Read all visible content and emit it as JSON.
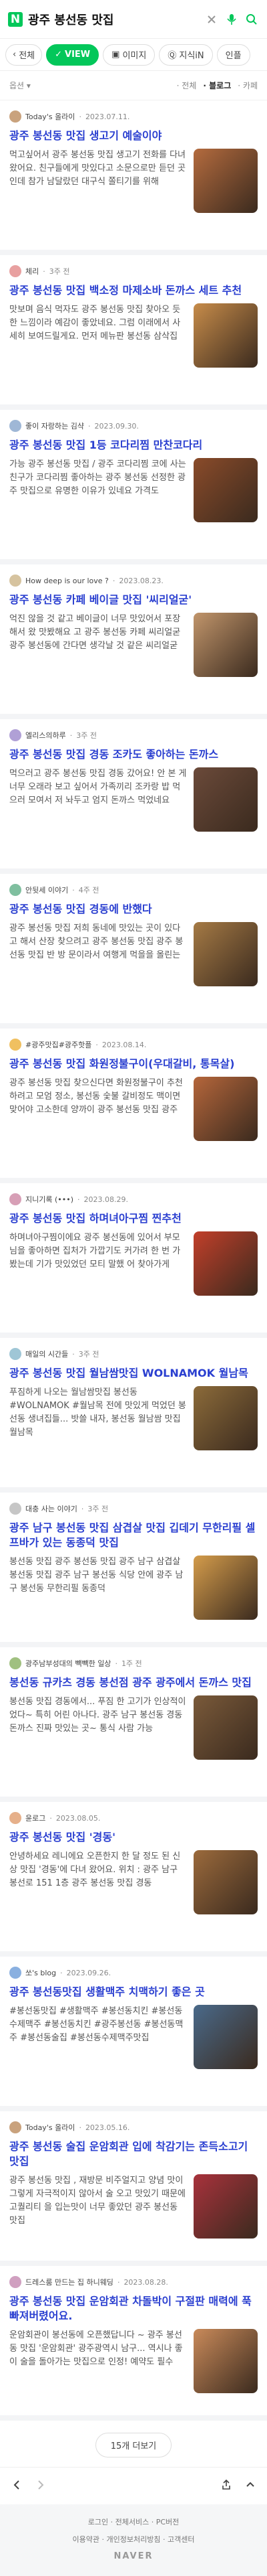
{
  "header": {
    "logo": "N",
    "query": "광주 봉선동 맛집"
  },
  "tabs": [
    {
      "label": "전체"
    },
    {
      "label": "VIEW"
    },
    {
      "label": "이미지"
    },
    {
      "label": "지식iN"
    },
    {
      "label": "인플"
    }
  ],
  "options": {
    "label": "옵션",
    "sort_all": "전체",
    "sort_blog": "블로그",
    "sort_cafe": "카페"
  },
  "posts": [
    {
      "author": "Today's 올라이",
      "date": "2023.07.11.",
      "avatar": "#c9a27d",
      "thumb": "#b46b3e",
      "title": "광주 봉선동 맛집 생고기 예술이야",
      "snippet": "먹고싶어서 광주 봉선동 맛집 생고기 전화를 다녀왔어요. 친구들에게 맛있다고 소문으로만 듣던 곳인데 참가 남달랐던 대구식 쫄티기를 위해"
    },
    {
      "author": "체리",
      "date": "3주 전",
      "avatar": "#e8a0a0",
      "thumb": "#c78c4a",
      "title": "광주 봉선동 맛집 백소정 마제소바 돈까스 세트 추천",
      "snippet": "맛보며 음식 먹자도 광주 봉선동 맛집 찾아오 듯한 느낌이라 예감이 좋았네요. 그럼 이래에서 사세히 보여드릴게요. 먼저 메뉴판 봉선동 삼삭집"
    },
    {
      "author": "좋이 자랑하는 김샥",
      "date": "2023.09.30.",
      "avatar": "#9fb7d6",
      "thumb": "#8a4b2a",
      "title": "광주 봉선동 맛집 1등 코다리찜 만찬코다리",
      "snippet": "가능 광주 봉선동 맛집 / 광주 코다리찜 코에 사는 친구가 코다리찜 좋아하는 광주 봉선동 선정한 광주 맛집으로 유명한 이유가 있네요 가격도"
    },
    {
      "author": "How deep is our love ?",
      "date": "2023.08.23.",
      "avatar": "#d6c39f",
      "thumb": "#c1956b",
      "title": "광주 봉선동 카페 베이글 맛집 '씨리얼굳'",
      "snippet": "억진 않을 것 같고 베이글이 너무 맛있어서 포장해서 왔 맛봤해요 고 광주 봉선동 카페 씨리얼굳 광주 봉선동에 간다면 생각날 것 같은 씨리얼굳"
    },
    {
      "author": "엘리스의하루",
      "date": "3주 전",
      "avatar": "#b0a0d6",
      "thumb": "#6b4a3a",
      "title": "광주 봉선동 맛집 경동 조카도 좋아하는 돈까스",
      "snippet": "먹으러고 광주 봉선동 맛집 경동 갔어요! 안 본 게 너무 오래라 보고 싶어서 가족끼리 조카랑 밥 먹으러 모여서 저 놔두고 엄지 돈까스 먹었네요"
    },
    {
      "author": "안뒷세 이야기",
      "date": "4주 전",
      "avatar": "#7fbf9f",
      "thumb": "#a57a45",
      "title": "광주 봉선동 맛집 경동에 반했다",
      "snippet": "광주 봉선동 맛집 저희 동네에 맛있는 곳이 있다고 해서 산장 찾으려고 광주 봉선동 맛집 광주 봉선동 맛집 반 방 문이라서 여행게 먹을을 올린는"
    },
    {
      "author": "#광주맛집#광주핫플",
      "date": "2023.08.14.",
      "avatar": "#f0c060",
      "thumb": "#b5663b",
      "title": "광주 봉선동 맛집 화원정불구이(우대갈비, 통목살)",
      "snippet": "광주 봉선동 맛집 찾으신다면 화원정불구이 추천하려고 모엄 정소, 봉선동 숯불 갈비정도 맥이면 맞어야 고소한데 양까이 광주 봉선동 맛집 광주"
    },
    {
      "author": "지니기록 (•••)",
      "date": "2023.08.29.",
      "avatar": "#d79fb6",
      "thumb": "#c23f2a",
      "title": "광주 봉선동 맛집 하며녀아구찜 찐추천",
      "snippet": "하며녀아구찜이에요 광주 봉선동에 있어서 부모님을 좋아하면 집처가 가깝기도 커가려 한 번 가봤는데 기가 맛있었던 모티 말했 어 찾아가게"
    },
    {
      "author": "매일의 시간들",
      "date": "3주 전",
      "avatar": "#9fc6d6",
      "thumb": "#8c6b3a",
      "title": "광주 봉선동 맛집 월남쌈맛집 WOLNAMOK 월남목",
      "snippet": "푸짐하게 나오는 월남쌈맛집 봉선동 #WOLNAMOK #월남목 전에 맛있게 먹었던 봉선동 생녀집들... 밧쓸 내자, 봉선동 월남쌈 맛집 월남목"
    },
    {
      "author": "대충 사는 이야기",
      "date": "3주 전",
      "avatar": "#c6c6c6",
      "thumb": "#d49c4b",
      "title": "광주 남구 봉선동 맛집 삼겹살 맛집 깁데기 무한리필 셀프바가 있는 동종덕 맛집",
      "snippet": "봉선동 맛집 광주 봉선동 맛집 광주 남구 삼겹살 봉선동 맛집 광주 남구 봉선동 식당 안에 광주 남구 봉선동 무한리필 동종덕"
    },
    {
      "author": "광주남부성대의 빽빽한 일상",
      "date": "1주 전",
      "avatar": "#a0c080",
      "thumb": "#7a5a3a",
      "title": "봉선동 규카츠 경동 봉선점 광주 광주에서 돈까스 맛집",
      "snippet": "봉선동 맛집 경동에서... 푸짐 한 고기가 인상적이었다~ 특히 어린 아나다. 광주 남구 봉선동 경동 돈까스 진짜 맛있는 곳~ 통식 사람 가능"
    },
    {
      "author": "윤로그",
      "date": "2023.08.05.",
      "avatar": "#e6b08a",
      "thumb": "#9b6a3c",
      "title": "광주 봉선동 맛집 '경동'",
      "snippet": "안녕하세요 레니에요 오픈한지 한 달 정도 된 신상 맛집 '경동'에 다녀 왔어요. 위치 : 광주 남구 봉선로 151 1층 광주 봉선동 맛집 경동"
    },
    {
      "author": "쏘's blog",
      "date": "2023.09.26.",
      "avatar": "#8ab0e0",
      "thumb": "#4a6a8a",
      "title": "광주 봉선동맛집 생활맥주 치맥하기 좋은 곳",
      "snippet": "#봉선동맛집 #생활맥주 #봉선동치킨 #봉선동수제맥주 #봉선동치킨 #광주봉선동 #봉선동맥주 #봉선동술집 #봉선동수제맥주맛집"
    },
    {
      "author": "Today's 올라이",
      "date": "2023.05.16.",
      "avatar": "#c9a27d",
      "thumb": "#a8323c",
      "title": "광주 봉선동 술집 운암회관 입에 착감기는 존득소고기 맛집",
      "snippet": "광주 봉선동 맛집 , 재방문 비주얼지고 양념 맛이 그렇게 자극적이지 않아서 술 오고 맛있기 때문에 고퀄리티 을 입는맛이 너무 좋았던 광주 봉선동 맛집"
    },
    {
      "author": "드레스룸 만드는 집 하니웨딩",
      "date": "2023.08.28.",
      "avatar": "#d0a0c0",
      "thumb": "#c98a5a",
      "title": "광주 봉선동 맛집 운암회관 차돌박이 구절판 매력에 푹 빠져버렸어요.",
      "snippet": "운암회관이 봉선동에 오픈했답니다 ~ 광주 봉선동 맛집 '운암회관' 광주광역시 남구... 역시나 좋이 술을 돌아가는 맛집으로 인정! 예약도 필수"
    }
  ],
  "more_label": "15개 더보기",
  "footer": {
    "links_1": "로그인 · 전체서비스 · PC버전",
    "links_2": "이용약관 · 개인정보처리방침 · 고객센터",
    "brand": "NAVER"
  }
}
